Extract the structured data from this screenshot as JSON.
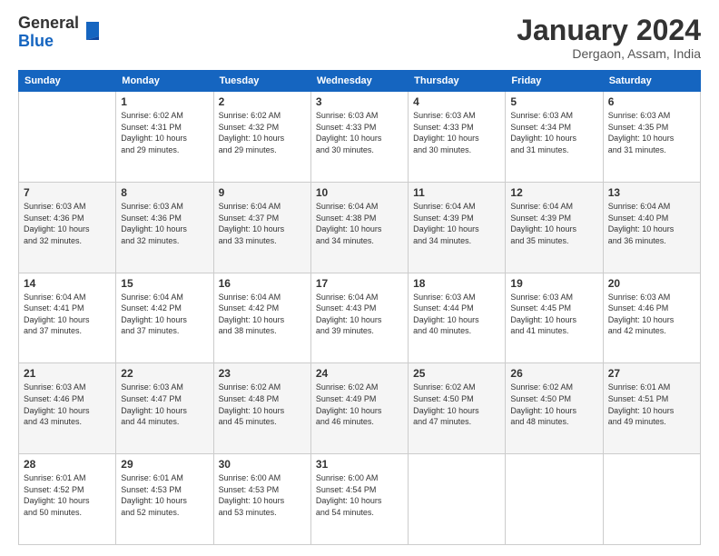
{
  "header": {
    "logo_general": "General",
    "logo_blue": "Blue",
    "month_title": "January 2024",
    "subtitle": "Dergaon, Assam, India"
  },
  "days_of_week": [
    "Sunday",
    "Monday",
    "Tuesday",
    "Wednesday",
    "Thursday",
    "Friday",
    "Saturday"
  ],
  "weeks": [
    [
      {
        "day": "",
        "info": ""
      },
      {
        "day": "1",
        "info": "Sunrise: 6:02 AM\nSunset: 4:31 PM\nDaylight: 10 hours\nand 29 minutes."
      },
      {
        "day": "2",
        "info": "Sunrise: 6:02 AM\nSunset: 4:32 PM\nDaylight: 10 hours\nand 29 minutes."
      },
      {
        "day": "3",
        "info": "Sunrise: 6:03 AM\nSunset: 4:33 PM\nDaylight: 10 hours\nand 30 minutes."
      },
      {
        "day": "4",
        "info": "Sunrise: 6:03 AM\nSunset: 4:33 PM\nDaylight: 10 hours\nand 30 minutes."
      },
      {
        "day": "5",
        "info": "Sunrise: 6:03 AM\nSunset: 4:34 PM\nDaylight: 10 hours\nand 31 minutes."
      },
      {
        "day": "6",
        "info": "Sunrise: 6:03 AM\nSunset: 4:35 PM\nDaylight: 10 hours\nand 31 minutes."
      }
    ],
    [
      {
        "day": "7",
        "info": "Sunrise: 6:03 AM\nSunset: 4:36 PM\nDaylight: 10 hours\nand 32 minutes."
      },
      {
        "day": "8",
        "info": "Sunrise: 6:03 AM\nSunset: 4:36 PM\nDaylight: 10 hours\nand 32 minutes."
      },
      {
        "day": "9",
        "info": "Sunrise: 6:04 AM\nSunset: 4:37 PM\nDaylight: 10 hours\nand 33 minutes."
      },
      {
        "day": "10",
        "info": "Sunrise: 6:04 AM\nSunset: 4:38 PM\nDaylight: 10 hours\nand 34 minutes."
      },
      {
        "day": "11",
        "info": "Sunrise: 6:04 AM\nSunset: 4:39 PM\nDaylight: 10 hours\nand 34 minutes."
      },
      {
        "day": "12",
        "info": "Sunrise: 6:04 AM\nSunset: 4:39 PM\nDaylight: 10 hours\nand 35 minutes."
      },
      {
        "day": "13",
        "info": "Sunrise: 6:04 AM\nSunset: 4:40 PM\nDaylight: 10 hours\nand 36 minutes."
      }
    ],
    [
      {
        "day": "14",
        "info": "Sunrise: 6:04 AM\nSunset: 4:41 PM\nDaylight: 10 hours\nand 37 minutes."
      },
      {
        "day": "15",
        "info": "Sunrise: 6:04 AM\nSunset: 4:42 PM\nDaylight: 10 hours\nand 37 minutes."
      },
      {
        "day": "16",
        "info": "Sunrise: 6:04 AM\nSunset: 4:42 PM\nDaylight: 10 hours\nand 38 minutes."
      },
      {
        "day": "17",
        "info": "Sunrise: 6:04 AM\nSunset: 4:43 PM\nDaylight: 10 hours\nand 39 minutes."
      },
      {
        "day": "18",
        "info": "Sunrise: 6:03 AM\nSunset: 4:44 PM\nDaylight: 10 hours\nand 40 minutes."
      },
      {
        "day": "19",
        "info": "Sunrise: 6:03 AM\nSunset: 4:45 PM\nDaylight: 10 hours\nand 41 minutes."
      },
      {
        "day": "20",
        "info": "Sunrise: 6:03 AM\nSunset: 4:46 PM\nDaylight: 10 hours\nand 42 minutes."
      }
    ],
    [
      {
        "day": "21",
        "info": "Sunrise: 6:03 AM\nSunset: 4:46 PM\nDaylight: 10 hours\nand 43 minutes."
      },
      {
        "day": "22",
        "info": "Sunrise: 6:03 AM\nSunset: 4:47 PM\nDaylight: 10 hours\nand 44 minutes."
      },
      {
        "day": "23",
        "info": "Sunrise: 6:02 AM\nSunset: 4:48 PM\nDaylight: 10 hours\nand 45 minutes."
      },
      {
        "day": "24",
        "info": "Sunrise: 6:02 AM\nSunset: 4:49 PM\nDaylight: 10 hours\nand 46 minutes."
      },
      {
        "day": "25",
        "info": "Sunrise: 6:02 AM\nSunset: 4:50 PM\nDaylight: 10 hours\nand 47 minutes."
      },
      {
        "day": "26",
        "info": "Sunrise: 6:02 AM\nSunset: 4:50 PM\nDaylight: 10 hours\nand 48 minutes."
      },
      {
        "day": "27",
        "info": "Sunrise: 6:01 AM\nSunset: 4:51 PM\nDaylight: 10 hours\nand 49 minutes."
      }
    ],
    [
      {
        "day": "28",
        "info": "Sunrise: 6:01 AM\nSunset: 4:52 PM\nDaylight: 10 hours\nand 50 minutes."
      },
      {
        "day": "29",
        "info": "Sunrise: 6:01 AM\nSunset: 4:53 PM\nDaylight: 10 hours\nand 52 minutes."
      },
      {
        "day": "30",
        "info": "Sunrise: 6:00 AM\nSunset: 4:53 PM\nDaylight: 10 hours\nand 53 minutes."
      },
      {
        "day": "31",
        "info": "Sunrise: 6:00 AM\nSunset: 4:54 PM\nDaylight: 10 hours\nand 54 minutes."
      },
      {
        "day": "",
        "info": ""
      },
      {
        "day": "",
        "info": ""
      },
      {
        "day": "",
        "info": ""
      }
    ]
  ]
}
